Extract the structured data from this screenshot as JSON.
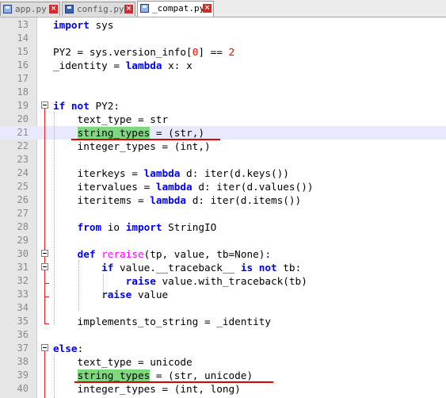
{
  "tabs": [
    {
      "label": "app.py",
      "active": false
    },
    {
      "label": "config.py",
      "active": false
    },
    {
      "label": "_compat.py",
      "active": true
    }
  ],
  "colors": {
    "keyword": "#0000ff",
    "function": "#ff00ff",
    "number": "#ff0000",
    "match_highlight": "#7fd77f",
    "fold_marker": "#e02020",
    "annotation": "#e00000"
  },
  "lines": [
    {
      "n": "13",
      "tokens": [
        {
          "t": "import",
          "c": "kw"
        },
        {
          "t": " sys"
        }
      ]
    },
    {
      "n": "14",
      "tokens": []
    },
    {
      "n": "15",
      "tokens": [
        {
          "t": "PY2 = sys.version_info["
        },
        {
          "t": "0",
          "c": "num"
        },
        {
          "t": "] == "
        },
        {
          "t": "2",
          "c": "num"
        }
      ]
    },
    {
      "n": "16",
      "tokens": [
        {
          "t": "_identity = "
        },
        {
          "t": "lambda",
          "c": "kw"
        },
        {
          "t": " x: x"
        }
      ]
    },
    {
      "n": "17",
      "tokens": []
    },
    {
      "n": "18",
      "tokens": []
    },
    {
      "n": "19",
      "tokens": [
        {
          "t": "if",
          "c": "kw"
        },
        {
          "t": " "
        },
        {
          "t": "not",
          "c": "kw"
        },
        {
          "t": " PY2:"
        }
      ]
    },
    {
      "n": "20",
      "tokens": [
        {
          "t": "    text_type = str"
        }
      ]
    },
    {
      "n": "21",
      "tokens": [
        {
          "t": "    "
        },
        {
          "t": "string_types",
          "c": "hl"
        },
        {
          "t": " = (str,)"
        }
      ]
    },
    {
      "n": "22",
      "tokens": [
        {
          "t": "    integer_types = (int,)"
        }
      ]
    },
    {
      "n": "23",
      "tokens": []
    },
    {
      "n": "24",
      "tokens": [
        {
          "t": "    iterkeys = "
        },
        {
          "t": "lambda",
          "c": "kw"
        },
        {
          "t": " d: iter(d.keys())"
        }
      ]
    },
    {
      "n": "25",
      "tokens": [
        {
          "t": "    itervalues = "
        },
        {
          "t": "lambda",
          "c": "kw"
        },
        {
          "t": " d: iter(d.values())"
        }
      ]
    },
    {
      "n": "26",
      "tokens": [
        {
          "t": "    iteritems = "
        },
        {
          "t": "lambda",
          "c": "kw"
        },
        {
          "t": " d: iter(d.items())"
        }
      ]
    },
    {
      "n": "27",
      "tokens": []
    },
    {
      "n": "28",
      "tokens": [
        {
          "t": "    "
        },
        {
          "t": "from",
          "c": "kw"
        },
        {
          "t": " io "
        },
        {
          "t": "import",
          "c": "kw"
        },
        {
          "t": " StringIO"
        }
      ]
    },
    {
      "n": "29",
      "tokens": []
    },
    {
      "n": "30",
      "tokens": [
        {
          "t": "    "
        },
        {
          "t": "def",
          "c": "kw"
        },
        {
          "t": " "
        },
        {
          "t": "reraise",
          "c": "fn"
        },
        {
          "t": "(tp, value, tb=None):"
        }
      ]
    },
    {
      "n": "31",
      "tokens": [
        {
          "t": "        "
        },
        {
          "t": "if",
          "c": "kw"
        },
        {
          "t": " value.__traceback__ "
        },
        {
          "t": "is",
          "c": "kw"
        },
        {
          "t": " "
        },
        {
          "t": "not",
          "c": "kw"
        },
        {
          "t": " tb:"
        }
      ]
    },
    {
      "n": "32",
      "tokens": [
        {
          "t": "            "
        },
        {
          "t": "raise",
          "c": "kw"
        },
        {
          "t": " value.with_traceback(tb)"
        }
      ]
    },
    {
      "n": "33",
      "tokens": [
        {
          "t": "        "
        },
        {
          "t": "raise",
          "c": "kw"
        },
        {
          "t": " value"
        }
      ]
    },
    {
      "n": "34",
      "tokens": []
    },
    {
      "n": "35",
      "tokens": [
        {
          "t": "    implements_to_string = _identity"
        }
      ]
    },
    {
      "n": "36",
      "tokens": []
    },
    {
      "n": "37",
      "tokens": [
        {
          "t": "else",
          "c": "kw"
        },
        {
          "t": ":"
        }
      ]
    },
    {
      "n": "38",
      "tokens": [
        {
          "t": "    text_type = unicode"
        }
      ]
    },
    {
      "n": "39",
      "tokens": [
        {
          "t": "    "
        },
        {
          "t": "string_types",
          "c": "hl"
        },
        {
          "t": " = (str, unicode)"
        }
      ]
    },
    {
      "n": "40",
      "tokens": [
        {
          "t": "    integer_types = (int, long)"
        }
      ]
    }
  ]
}
